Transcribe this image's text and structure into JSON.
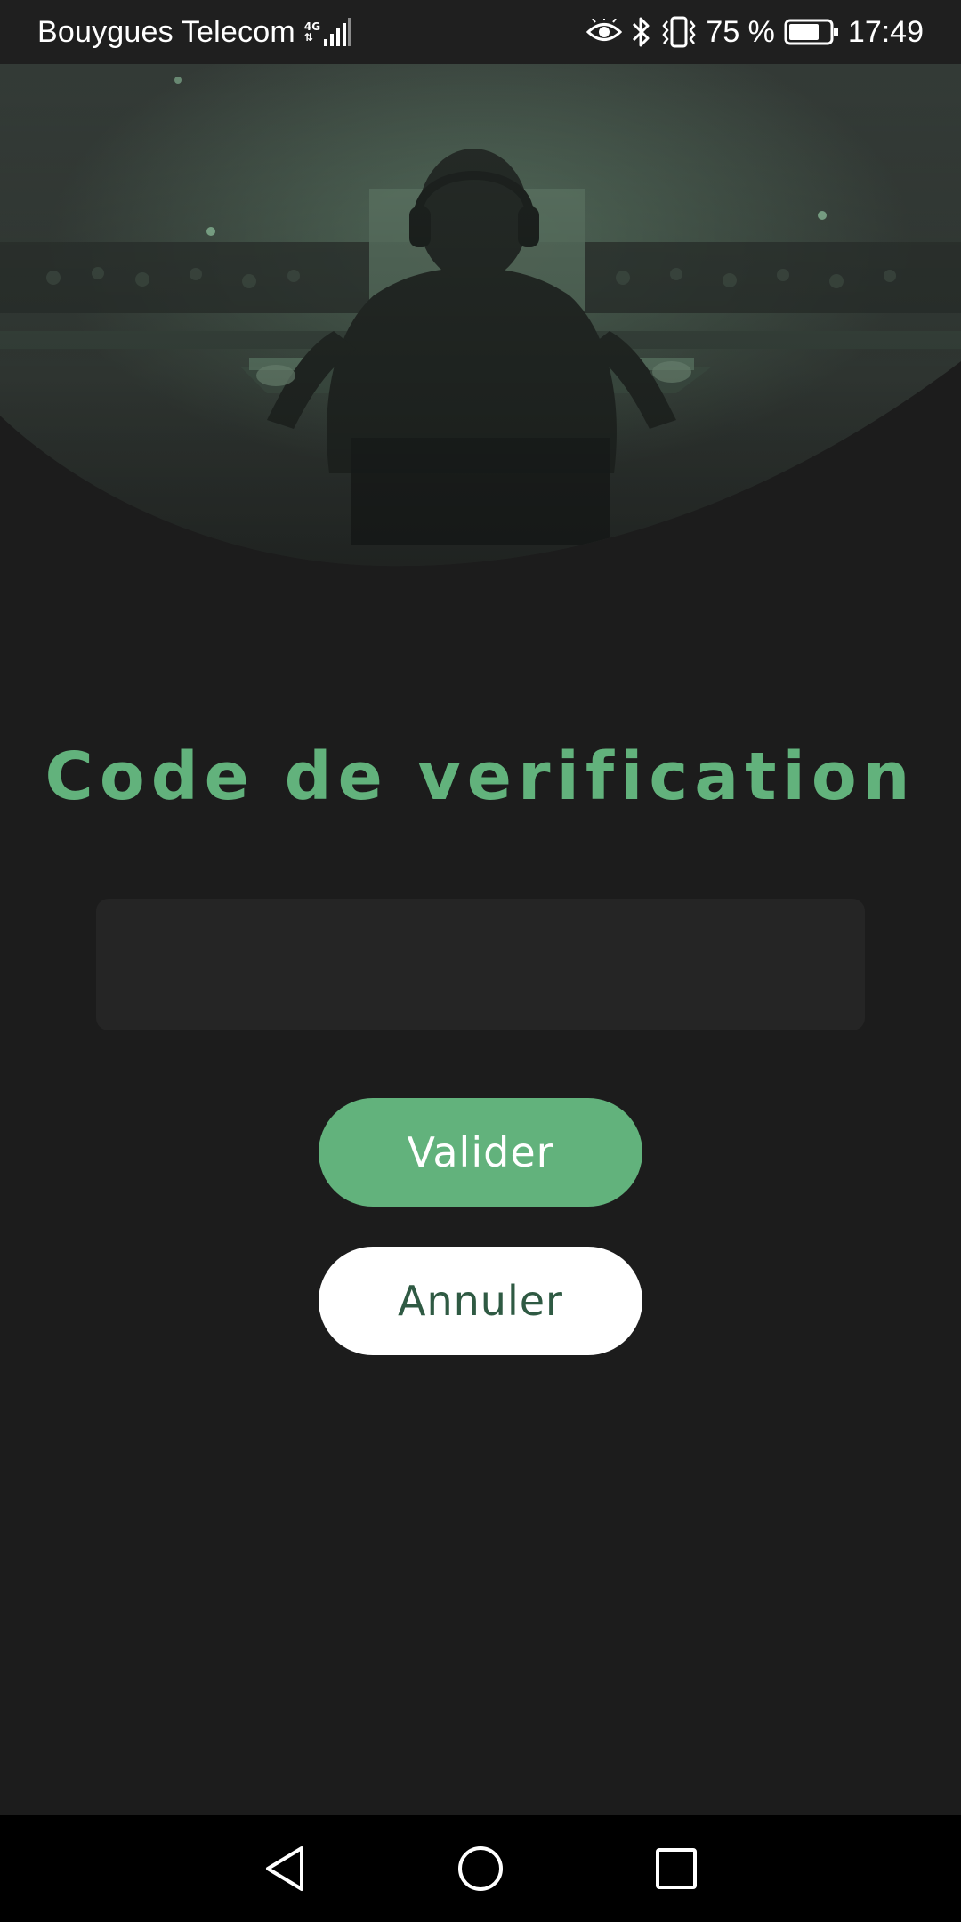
{
  "status_bar": {
    "carrier": "Bouygues Telecom",
    "network_type": "4G",
    "battery_percent": "75 %",
    "battery_level": 0.75,
    "time": "17:49",
    "icons": [
      "signal-icon",
      "eye-comfort-icon",
      "bluetooth-icon",
      "vibrate-icon",
      "battery-icon"
    ]
  },
  "hero": {
    "image": "gamer-wearing-headset-at-esports-arena"
  },
  "verification": {
    "title": "Code de verification",
    "code_value": "",
    "code_placeholder": ""
  },
  "actions": {
    "validate_label": "Valider",
    "cancel_label": "Annuler"
  },
  "navigation": {
    "icons": [
      "back-icon",
      "home-icon",
      "recents-icon"
    ]
  },
  "colors": {
    "background": "#1c1c1c",
    "accent": "#62b27c",
    "input_background": "#252525",
    "cancel_text": "#2f5a43",
    "nav_bar": "#000000"
  }
}
